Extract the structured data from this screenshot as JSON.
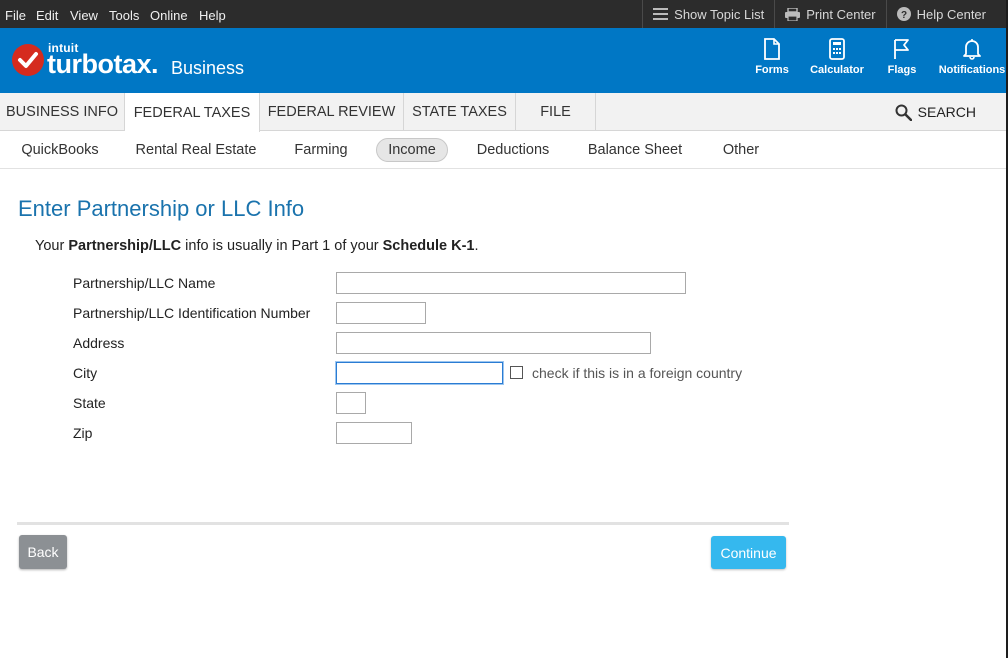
{
  "menubar": {
    "items": [
      "File",
      "Edit",
      "View",
      "Tools",
      "Online",
      "Help"
    ],
    "show_topic_list": "Show Topic List",
    "print_center": "Print Center",
    "help_center": "Help Center"
  },
  "header": {
    "brand_small": "intuit",
    "brand": "turbotax.",
    "product": "Business",
    "tools": [
      "Forms",
      "Calculator",
      "Flags",
      "Notifications"
    ]
  },
  "tabs": {
    "items": [
      "BUSINESS INFO",
      "FEDERAL TAXES",
      "FEDERAL REVIEW",
      "STATE TAXES",
      "FILE"
    ],
    "active": "FEDERAL TAXES",
    "search": "SEARCH"
  },
  "subtabs": {
    "items": [
      "QuickBooks",
      "Rental Real Estate",
      "Farming",
      "Income",
      "Deductions",
      "Balance Sheet",
      "Other"
    ],
    "active": "Income"
  },
  "form": {
    "title": "Enter Partnership or LLC Info",
    "intro_pre": "Your ",
    "intro_bold1": "Partnership/LLC",
    "intro_mid": " info is usually in Part 1 of your ",
    "intro_bold2": "Schedule K-1",
    "intro_end": ".",
    "fields": {
      "name": {
        "label": "Partnership/LLC Name",
        "value": ""
      },
      "ein": {
        "label": "Partnership/LLC Identification Number",
        "value": ""
      },
      "address": {
        "label": "Address",
        "value": ""
      },
      "city": {
        "label": "City",
        "value": ""
      },
      "state": {
        "label": "State",
        "value": ""
      },
      "zip": {
        "label": "Zip",
        "value": ""
      }
    },
    "foreign_checkbox_label": "check if this is in a foreign country",
    "foreign_checked": false
  },
  "buttons": {
    "back": "Back",
    "continue": "Continue"
  },
  "colors": {
    "brand_blue": "#0077c5",
    "title_blue": "#1a73ad",
    "continue": "#35b8ee",
    "back": "#8c9094"
  }
}
